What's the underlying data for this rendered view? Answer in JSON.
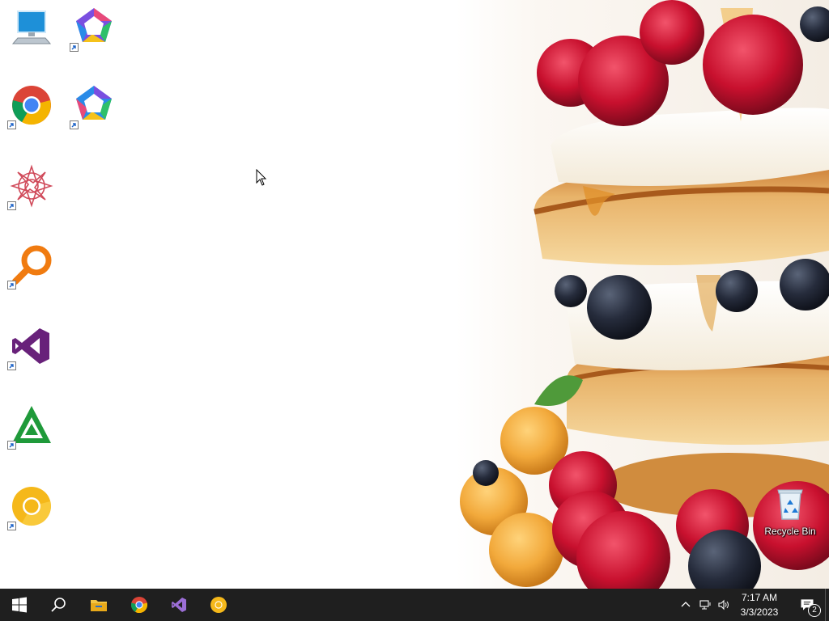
{
  "desktop": {
    "icons": [
      {
        "name": "this-pc-icon"
      },
      {
        "name": "app-pentagon-icon-1"
      },
      {
        "name": "chrome-icon"
      },
      {
        "name": "app-pentagon-icon-2"
      },
      {
        "name": "mandala-app-icon"
      },
      {
        "name": "search-magnifier-app-icon"
      },
      {
        "name": "visual-studio-icon"
      },
      {
        "name": "green-triangle-app-icon"
      },
      {
        "name": "chrome-canary-icon"
      }
    ],
    "recycle_bin": {
      "label": "Recycle Bin"
    }
  },
  "taskbar": {
    "pinned": [
      {
        "name": "start-button"
      },
      {
        "name": "search-button"
      },
      {
        "name": "file-explorer-button"
      },
      {
        "name": "chrome-button"
      },
      {
        "name": "visual-studio-button"
      },
      {
        "name": "chrome-canary-button"
      }
    ],
    "tray": {
      "time": "7:17 AM",
      "date": "3/3/2023",
      "notification_count": "2"
    }
  },
  "colors": {
    "taskbar": "#1f1f1f",
    "chrome_red": "#db4437",
    "chrome_green": "#0f9d58",
    "chrome_yellow": "#f4b400",
    "chrome_blue": "#4285f4",
    "vs_purple": "#68217a",
    "raspberry": "#c8102e"
  }
}
